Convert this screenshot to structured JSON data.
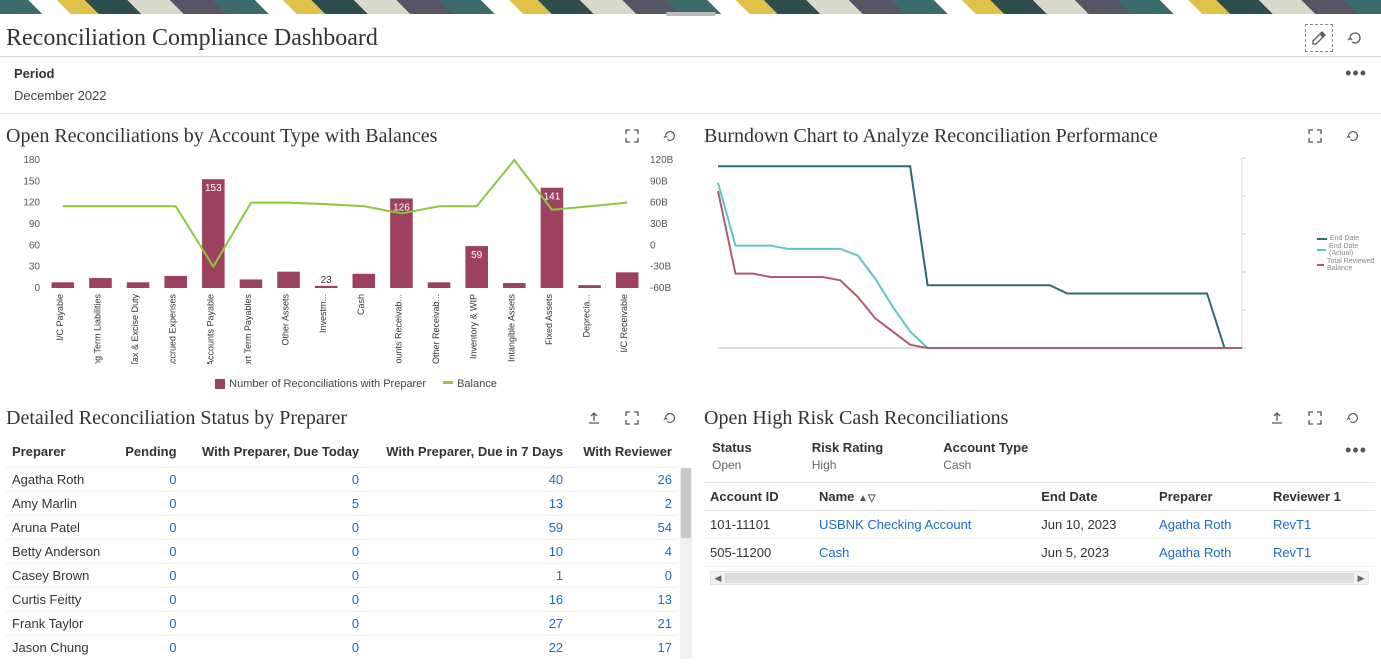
{
  "header": {
    "title": "Reconciliation Compliance Dashboard"
  },
  "period": {
    "label": "Period",
    "value": "December 2022"
  },
  "panels": {
    "open_by_type": {
      "title": "Open Reconciliations by Account Type with Balances",
      "legend_a": "Number of Reconciliations with Preparer",
      "legend_b": "Balance"
    },
    "burndown": {
      "title": "Burndown Chart to Analyze Reconciliation Performance",
      "legend": [
        "End Date",
        "End Date (Actual)",
        "Total Reviewed Balance"
      ]
    },
    "status_by_preparer": {
      "title": "Detailed Reconciliation Status by Preparer",
      "columns": [
        "Preparer",
        "Pending",
        "With Preparer, Due Today",
        "With Preparer, Due in 7 Days",
        "With Reviewer"
      ]
    },
    "high_risk": {
      "title": "Open High Risk Cash Reconciliations",
      "filters": {
        "status_label": "Status",
        "status_value": "Open",
        "risk_label": "Risk Rating",
        "risk_value": "High",
        "type_label": "Account Type",
        "type_value": "Cash"
      },
      "columns": [
        "Account ID",
        "Name",
        "End Date",
        "Preparer",
        "Reviewer 1"
      ]
    }
  },
  "chart_data": [
    {
      "type": "bar+line",
      "title": "Open Reconciliations by Account Type with Balances",
      "categories": [
        "I/C Payable",
        "Long Term Liabilities",
        "Tax & Excise Duty",
        "Accrued Expenses",
        "Accounts Payable",
        "Short Term Payables",
        "Other Assets",
        "Investm...",
        "Cash",
        "Accounts Receivab...",
        "Other Receivab...",
        "Inventory & WIP",
        "Intangible Assets",
        "Fixed Assets",
        "Deprecia...",
        "I/C Receivable"
      ],
      "bars": {
        "name": "Number of Reconciliations with Preparer",
        "values": [
          8,
          14,
          8,
          17,
          153,
          12,
          23,
          3,
          20,
          126,
          8,
          59,
          7,
          141,
          4,
          22
        ]
      },
      "bar_labels": {
        "4": "153",
        "7": "23",
        "9": "126",
        "11": "59",
        "13": "141"
      },
      "line": {
        "name": "Balance",
        "values_billion": [
          55,
          55,
          55,
          55,
          -30,
          60,
          60,
          58,
          55,
          45,
          55,
          55,
          120,
          50,
          55,
          60
        ]
      },
      "y_left": {
        "label": "",
        "ticks": [
          0,
          30,
          60,
          90,
          120,
          150,
          180
        ]
      },
      "y_right": {
        "label": "",
        "ticks": [
          "-60B",
          "-30B",
          "0",
          "30B",
          "60B",
          "90B",
          "120B"
        ]
      }
    },
    {
      "type": "line",
      "title": "Burndown Chart to Analyze Reconciliation Performance",
      "x": [
        0,
        1,
        2,
        3,
        4,
        5,
        6,
        7,
        8,
        9,
        10,
        11,
        12,
        13,
        14,
        15,
        16,
        17,
        18,
        19,
        20,
        21,
        22,
        23,
        24,
        25,
        26,
        27,
        28,
        29,
        30
      ],
      "series": [
        {
          "name": "End Date",
          "color": "#2b6d6d",
          "values": [
            110,
            110,
            110,
            110,
            110,
            110,
            110,
            110,
            110,
            110,
            110,
            110,
            38,
            38,
            38,
            38,
            38,
            38,
            38,
            38,
            33,
            33,
            33,
            33,
            33,
            33,
            33,
            33,
            33,
            0,
            0
          ]
        },
        {
          "name": "End Date (Actual)",
          "color": "#5fc7c1",
          "values": [
            100,
            62,
            62,
            62,
            60,
            60,
            60,
            60,
            56,
            42,
            25,
            10,
            0,
            0,
            0,
            0,
            0,
            0,
            0,
            0,
            0,
            0,
            0,
            0,
            0,
            0,
            0,
            0,
            0,
            0,
            0
          ]
        },
        {
          "name": "Total Reviewed Balance",
          "color": "#b35a6c",
          "values": [
            95,
            45,
            45,
            43,
            43,
            43,
            43,
            41,
            31,
            18,
            10,
            2,
            0,
            0,
            0,
            0,
            0,
            0,
            0,
            0,
            0,
            0,
            0,
            0,
            0,
            0,
            0,
            0,
            0,
            0,
            0
          ]
        }
      ],
      "ylim": [
        0,
        115
      ]
    }
  ],
  "preparer_rows": [
    {
      "name": "Agatha Roth",
      "pending": 0,
      "due_today": 0,
      "due_7": 40,
      "with_rev": 26
    },
    {
      "name": "Amy Marlin",
      "pending": 0,
      "due_today": 5,
      "due_7": 13,
      "with_rev": 2
    },
    {
      "name": "Aruna Patel",
      "pending": 0,
      "due_today": 0,
      "due_7": 59,
      "with_rev": 54
    },
    {
      "name": "Betty Anderson",
      "pending": 0,
      "due_today": 0,
      "due_7": 10,
      "with_rev": 4
    },
    {
      "name": "Casey Brown",
      "pending": 0,
      "due_today": 0,
      "due_7": 1,
      "with_rev": 0
    },
    {
      "name": "Curtis Feitty",
      "pending": 0,
      "due_today": 0,
      "due_7": 16,
      "with_rev": 13
    },
    {
      "name": "Frank Taylor",
      "pending": 0,
      "due_today": 0,
      "due_7": 27,
      "with_rev": 21
    },
    {
      "name": "Jason Chung",
      "pending": 0,
      "due_today": 0,
      "due_7": 22,
      "with_rev": 17
    }
  ],
  "risk_rows": [
    {
      "id": "101-11101",
      "name": "USBNK Checking Account",
      "end": "Jun 10, 2023",
      "prep": "Agatha Roth",
      "rev": "RevT1"
    },
    {
      "id": "505-11200",
      "name": "Cash",
      "end": "Jun 5, 2023",
      "prep": "Agatha Roth",
      "rev": "RevT1"
    }
  ]
}
